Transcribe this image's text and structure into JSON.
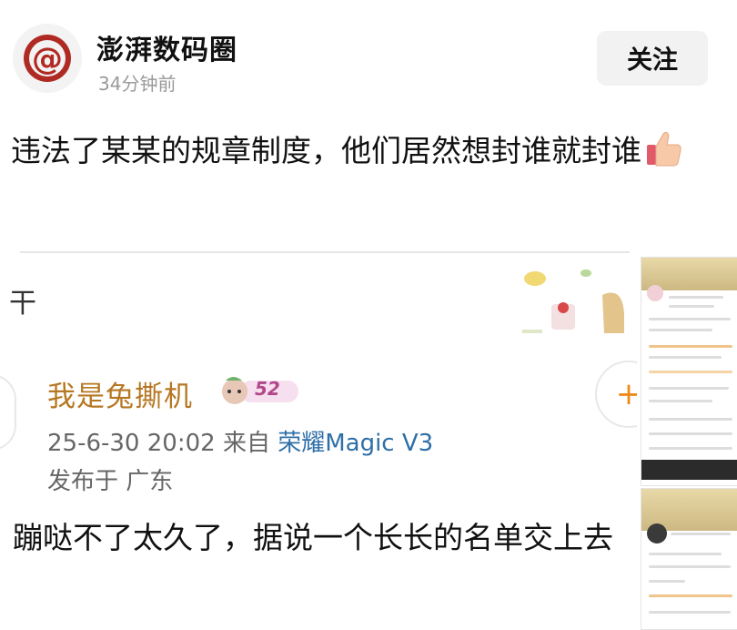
{
  "header": {
    "author_name": "澎湃数码圈",
    "time_ago": "34分钟前",
    "follow_label": "关注",
    "avatar_letter": "@"
  },
  "post": {
    "text": "违法了某某的规章制度，他们居然想封谁就封谁",
    "emoji": "thumbs-up-icon"
  },
  "embedded_screenshot": {
    "edge_char": "干",
    "username": "我是兔撕机",
    "badge_level": "52",
    "add_icon": "+",
    "datetime": "25-6-30 20:02",
    "source_prefix": "来自",
    "device": "荣耀Magic V3",
    "region": "发布于 广东",
    "body_text": "蹦哒不了太久了，据说一个长长的名单交上去"
  },
  "colors": {
    "username": "#b67722",
    "device_link": "#2f6fa8",
    "accent_orange": "#ee8a1a",
    "badge": "#b1478a"
  }
}
